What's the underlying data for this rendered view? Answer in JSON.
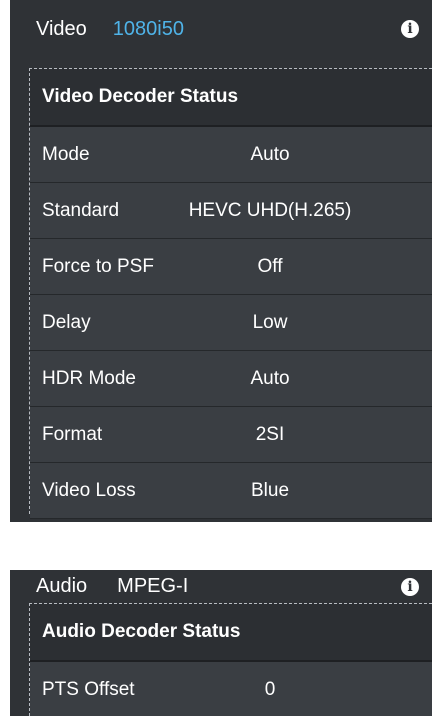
{
  "video": {
    "header_title": "Video",
    "header_value": "1080i50",
    "section_title": "Video Decoder Status",
    "rows": [
      {
        "label": "Mode",
        "value": "Auto"
      },
      {
        "label": "Standard",
        "value": "HEVC UHD(H.265)"
      },
      {
        "label": "Force to PSF",
        "value": "Off"
      },
      {
        "label": "Delay",
        "value": "Low"
      },
      {
        "label": "HDR Mode",
        "value": "Auto"
      },
      {
        "label": "Format",
        "value": "2SI"
      },
      {
        "label": "Video Loss",
        "value": "Blue"
      }
    ]
  },
  "audio": {
    "header_title": "Audio",
    "header_value": "MPEG-I",
    "section_title": "Audio Decoder Status",
    "rows": [
      {
        "label": "PTS Offset",
        "value": "0"
      }
    ]
  },
  "icons": {
    "info": "i"
  },
  "colors": {
    "panel_bg": "#2f3236",
    "row_bg": "#3a3e43",
    "accent_value": "#4fb3e8"
  }
}
